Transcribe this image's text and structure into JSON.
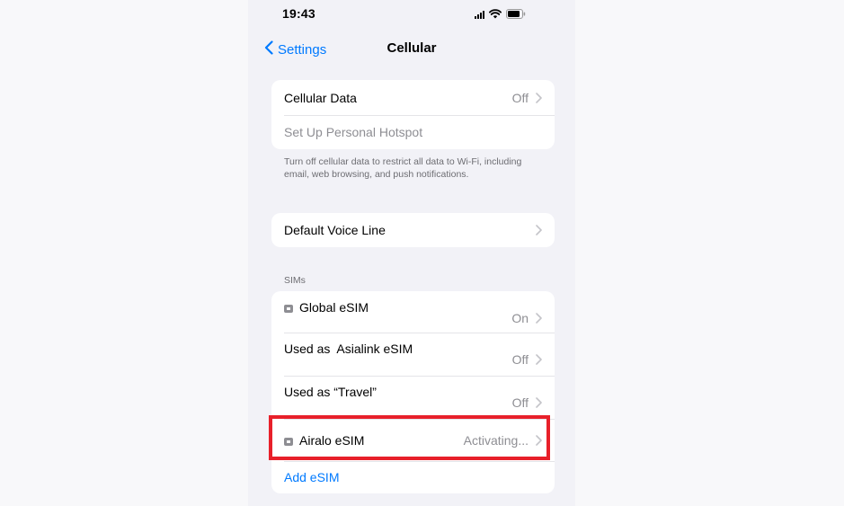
{
  "status_bar": {
    "time": "19:43"
  },
  "nav": {
    "back_label": "Settings",
    "title": "Cellular"
  },
  "data_group": {
    "cellular_data": {
      "label": "Cellular Data",
      "value": "Off"
    },
    "hotspot": {
      "label": "Set Up Personal Hotspot"
    },
    "footnote": "Turn off cellular data to restrict all data to Wi-Fi, including email, web browsing, and push notifications."
  },
  "voice_group": {
    "default_voice_line": {
      "label": "Default Voice Line"
    }
  },
  "sims_section": {
    "header": "SIMs",
    "items": [
      {
        "label": "Global eSIM",
        "value": "On"
      },
      {
        "label": "Used as  Asialink eSIM",
        "value": "Off"
      },
      {
        "label": "Used as “Travel”",
        "value": "Off"
      },
      {
        "label": "Airalo eSIM",
        "value": "Activating..."
      }
    ],
    "add_esim_label": "Add eSIM"
  },
  "colors": {
    "accent": "#007aff",
    "highlight": "#e8202a",
    "background": "#f2f2f7"
  },
  "icons": {
    "back": "chevron-left-icon",
    "row_disclosure": "chevron-right-icon",
    "sim": "sim-icon",
    "signal": "signal-icon",
    "wifi": "wifi-icon",
    "battery": "battery-icon"
  }
}
